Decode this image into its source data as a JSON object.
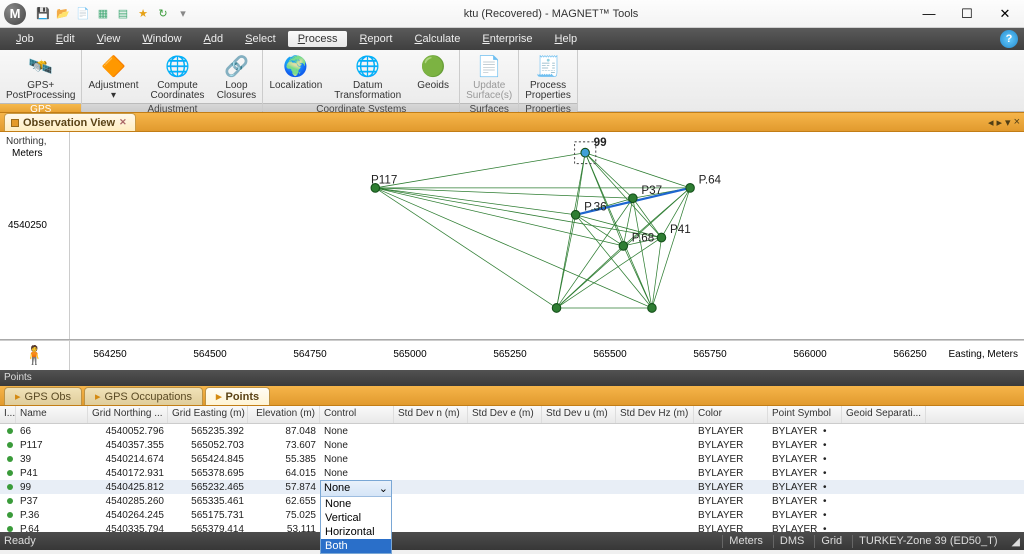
{
  "window": {
    "title": "ktu (Recovered)  - MAGNET™ Tools",
    "logo_letter": "M"
  },
  "qat_icons": [
    "save-icon",
    "open-icon",
    "new-icon",
    "grid-icon",
    "grid2-icon",
    "star-icon",
    "redo-icon"
  ],
  "menu": [
    "Job",
    "Edit",
    "View",
    "Window",
    "Add",
    "Select",
    "Process",
    "Report",
    "Calculate",
    "Enterprise",
    "Help"
  ],
  "menu_active": "Process",
  "ribbon": {
    "groups": [
      {
        "label": "GPS",
        "highlighted": true,
        "buttons": [
          {
            "name": "gps-postprocessing-button",
            "icon": "🛰️",
            "text": "GPS+\nPostProcessing"
          }
        ]
      },
      {
        "label": "Adjustment",
        "buttons": [
          {
            "name": "adjustment-button",
            "icon": "🔶",
            "text": "Adjustment\n▾"
          },
          {
            "name": "compute-coordinates-button",
            "icon": "🌐",
            "text": "Compute\nCoordinates"
          },
          {
            "name": "loop-closures-button",
            "icon": "🔗",
            "text": "Loop\nClosures"
          }
        ]
      },
      {
        "label": "Coordinate Systems",
        "buttons": [
          {
            "name": "localization-button",
            "icon": "🌍",
            "text": "Localization"
          },
          {
            "name": "datum-transformation-button",
            "icon": "🌐",
            "text": "Datum\nTransformation"
          },
          {
            "name": "geoids-button",
            "icon": "🟢",
            "text": "Geoids"
          }
        ]
      },
      {
        "label": "Surfaces",
        "buttons": [
          {
            "name": "update-surfaces-button",
            "icon": "📄",
            "text": "Update\nSurface(s)",
            "disabled": true
          }
        ]
      },
      {
        "label": "Properties",
        "buttons": [
          {
            "name": "process-properties-button",
            "icon": "🧾",
            "text": "Process\nProperties"
          }
        ]
      }
    ]
  },
  "doc_tab": {
    "label": "Observation View",
    "close": "✕"
  },
  "yaxis": {
    "label1": "Northing,",
    "label2": "Meters",
    "tick": "4540250"
  },
  "xaxis": {
    "label": "Easting, Meters",
    "ticks": [
      "564250",
      "564500",
      "564750",
      "565000",
      "565250",
      "565500",
      "565750",
      "566000",
      "566250"
    ]
  },
  "network_points": {
    "P117": [
      0.32,
      0.27
    ],
    "99": [
      0.54,
      0.1
    ],
    "P.64": [
      0.65,
      0.27
    ],
    "P37": [
      0.59,
      0.32
    ],
    "P.36": [
      0.53,
      0.4
    ],
    "P41": [
      0.62,
      0.51
    ],
    "P.68": [
      0.58,
      0.55
    ],
    "A": [
      0.51,
      0.85
    ],
    "B": [
      0.61,
      0.85
    ]
  },
  "points_panel": {
    "title": "Points"
  },
  "points_tabs": [
    "GPS Obs",
    "GPS Occupations",
    "Points"
  ],
  "points_tab_active": "Points",
  "columns": [
    "I...",
    "Name",
    "Grid Northing ...",
    "Grid Easting (m)",
    "Elevation (m)",
    "Control",
    "Std Dev n (m)",
    "Std Dev e (m)",
    "Std Dev u (m)",
    "Std Dev Hz (m)",
    "Color",
    "Point Symbol",
    "Geoid Separati..."
  ],
  "rows": [
    {
      "name": "66",
      "n": "4540052.796",
      "e": "565235.392",
      "el": "87.048",
      "ctrl": "None",
      "color": "BYLAYER",
      "sym": "BYLAYER"
    },
    {
      "name": "P117",
      "n": "4540357.355",
      "e": "565052.703",
      "el": "73.607",
      "ctrl": "None",
      "color": "BYLAYER",
      "sym": "BYLAYER"
    },
    {
      "name": "39",
      "n": "4540214.674",
      "e": "565424.845",
      "el": "55.385",
      "ctrl": "None",
      "color": "BYLAYER",
      "sym": "BYLAYER"
    },
    {
      "name": "P41",
      "n": "4540172.931",
      "e": "565378.695",
      "el": "64.015",
      "ctrl": "None",
      "color": "BYLAYER",
      "sym": "BYLAYER"
    },
    {
      "name": "99",
      "n": "4540425.812",
      "e": "565232.465",
      "el": "57.874",
      "ctrl": "None",
      "color": "BYLAYER",
      "sym": "BYLAYER",
      "selected": true
    },
    {
      "name": "P37",
      "n": "4540285.260",
      "e": "565335.461",
      "el": "62.655",
      "ctrl": "",
      "color": "BYLAYER",
      "sym": "BYLAYER"
    },
    {
      "name": "P.36",
      "n": "4540264.245",
      "e": "565175.731",
      "el": "75.025",
      "ctrl": "",
      "color": "BYLAYER",
      "sym": "BYLAYER"
    },
    {
      "name": "P.64",
      "n": "4540335.794",
      "e": "565379.414",
      "el": "53.111",
      "ctrl": "",
      "color": "BYLAYER",
      "sym": "BYLAYER"
    }
  ],
  "control_dropdown": {
    "selected_display": "None",
    "options": [
      "None",
      "Vertical",
      "Horizontal",
      "Both"
    ],
    "highlighted": "Both"
  },
  "dot_char": "•",
  "status": {
    "left": "Ready",
    "right": [
      "Meters",
      "DMS",
      "Grid",
      "TURKEY-Zone 39 (ED50_T)"
    ]
  }
}
